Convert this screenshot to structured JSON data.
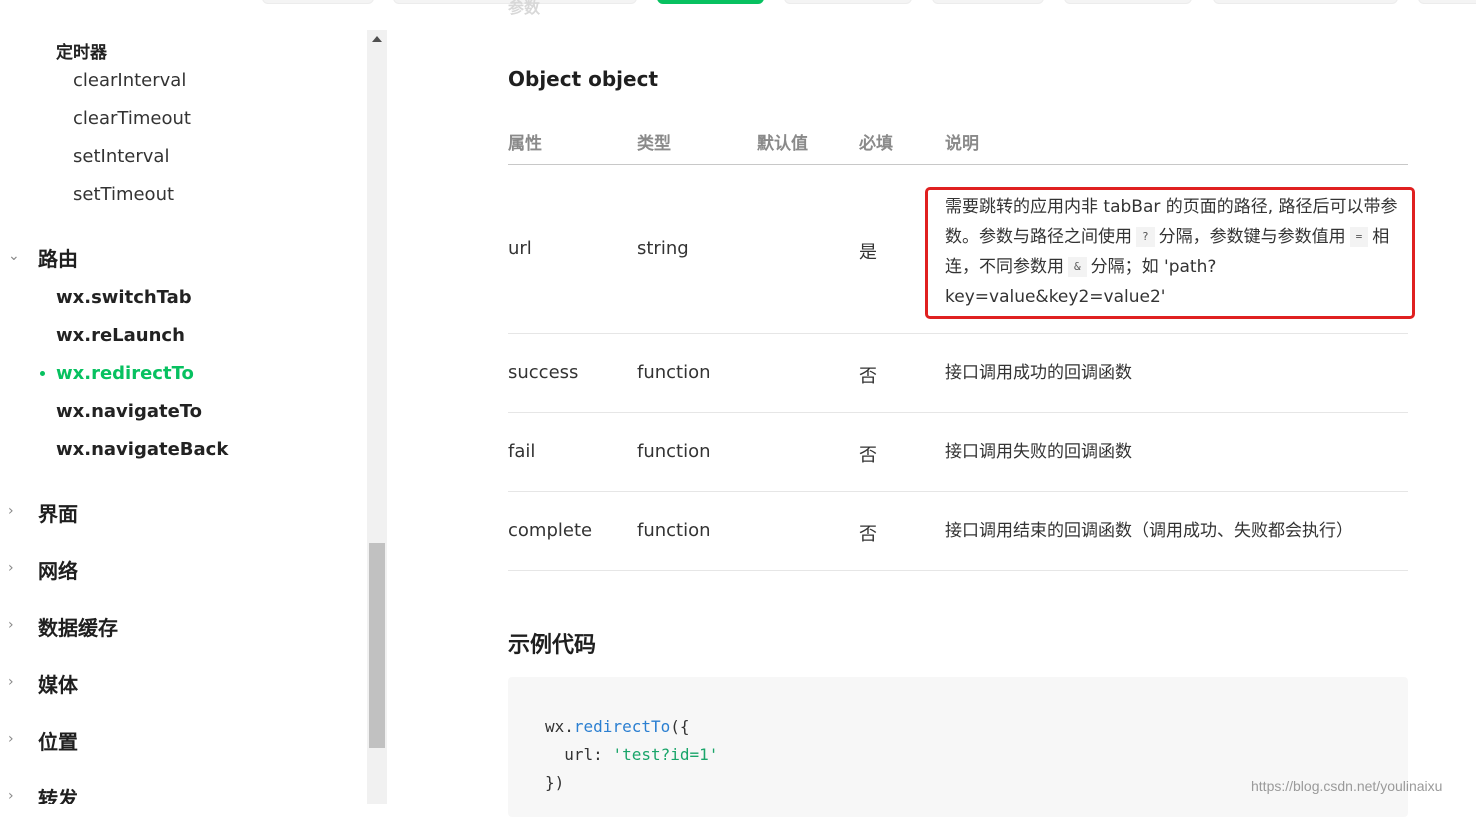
{
  "top_ghost_text": "参数",
  "sidebar": {
    "timer": {
      "title": "定时器",
      "items": [
        "clearInterval",
        "clearTimeout",
        "setInterval",
        "setTimeout"
      ]
    },
    "routing": {
      "label": "路由",
      "items": [
        "wx.switchTab",
        "wx.reLaunch",
        "wx.redirectTo",
        "wx.navigateTo",
        "wx.navigateBack"
      ],
      "active": "wx.redirectTo"
    },
    "groups": [
      "界面",
      "网络",
      "数据缓存",
      "媒体",
      "位置",
      "转发"
    ]
  },
  "main": {
    "object_heading": "Object object",
    "table": {
      "headers": [
        "属性",
        "类型",
        "默认值",
        "必填",
        "说明"
      ],
      "rows": [
        {
          "name": "url",
          "type": "string",
          "default": "",
          "required": "是",
          "desc_parts": [
            "需要跳转的应用内非 tabBar 的页面的路径, 路径后可以带参数。参数与路径之间使用",
            "?",
            "分隔，参数键与参数值用",
            "=",
            "相连，不同参数用",
            "&",
            "分隔；如 'path?key=value&key2=value2'"
          ]
        },
        {
          "name": "success",
          "type": "function",
          "default": "",
          "required": "否",
          "desc": "接口调用成功的回调函数"
        },
        {
          "name": "fail",
          "type": "function",
          "default": "",
          "required": "否",
          "desc": "接口调用失败的回调函数"
        },
        {
          "name": "complete",
          "type": "function",
          "default": "",
          "required": "否",
          "desc": "接口调用结束的回调函数（调用成功、失败都会执行）"
        }
      ]
    },
    "example_heading": "示例代码",
    "code": {
      "line1_obj": "wx.",
      "line1_fn": "redirectTo",
      "line1_end": "({",
      "line2_key": "  url: ",
      "line2_val": "'test?id=1'",
      "line3": "})"
    }
  },
  "watermark": "https://blog.csdn.net/youlinaixu",
  "colors": {
    "accent": "#07c160",
    "highlight_border": "#e02020"
  }
}
